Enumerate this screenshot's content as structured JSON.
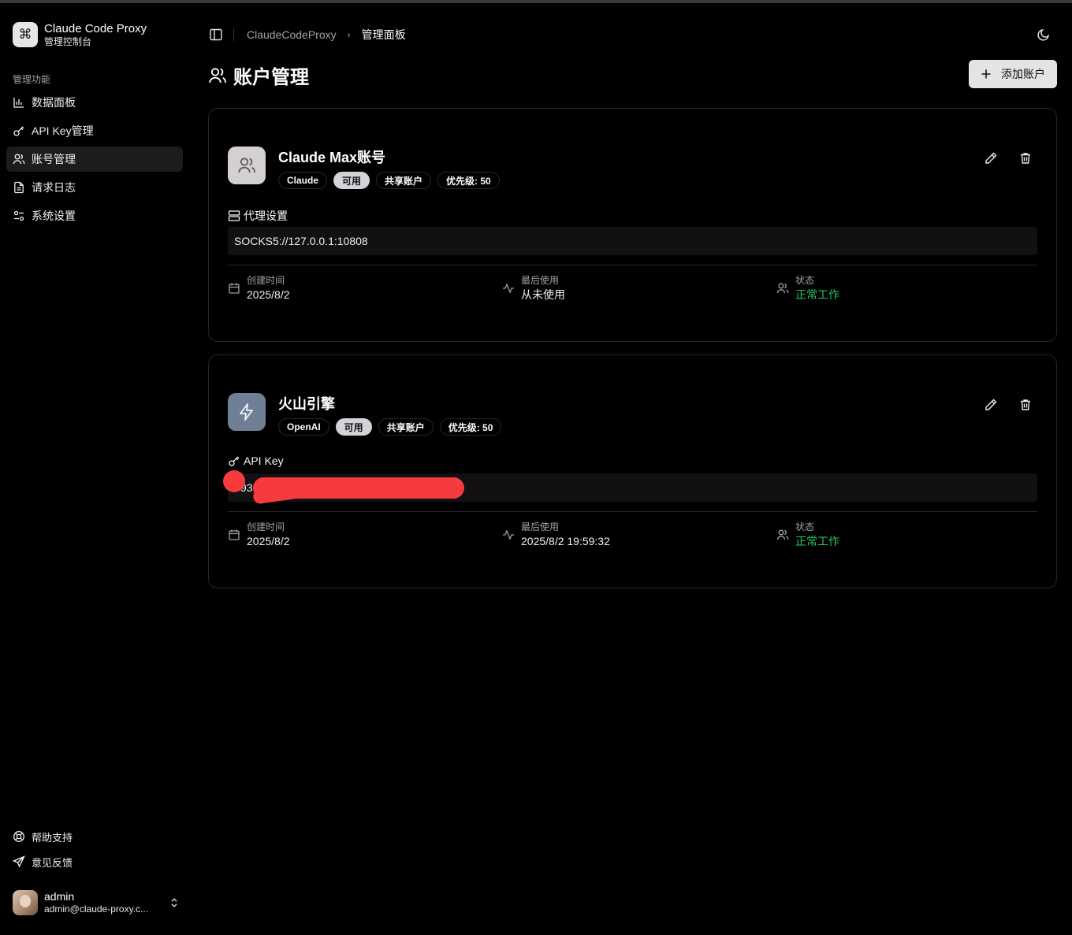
{
  "app": {
    "name": "Claude Code Proxy",
    "subtitle": "管理控制台"
  },
  "sidebar": {
    "section_label": "管理功能",
    "items": [
      {
        "label": "数据面板",
        "icon": "bar-chart-icon"
      },
      {
        "label": "API Key管理",
        "icon": "key-icon"
      },
      {
        "label": "账号管理",
        "icon": "users-icon",
        "active": true
      },
      {
        "label": "请求日志",
        "icon": "file-text-icon"
      },
      {
        "label": "系统设置",
        "icon": "settings-sliders-icon"
      }
    ],
    "footer_items": [
      {
        "label": "帮助支持",
        "icon": "life-buoy-icon"
      },
      {
        "label": "意见反馈",
        "icon": "send-icon"
      }
    ]
  },
  "user": {
    "name": "admin",
    "email": "admin@claude-proxy.c..."
  },
  "breadcrumb": {
    "root": "ClaudeCodeProxy",
    "current": "管理面板"
  },
  "page": {
    "title": "账户管理",
    "add_button": "添加账户"
  },
  "accounts": [
    {
      "name": "Claude Max账号",
      "icon": "users-icon",
      "badges": [
        "Claude",
        "可用",
        "共享账户",
        "优先级: 50"
      ],
      "field_label": "代理设置",
      "field_icon": "server-icon",
      "field_value": "SOCKS5://127.0.0.1:10808",
      "created_label": "创建时间",
      "created_value": "2025/8/2",
      "last_used_label": "最后使用",
      "last_used_value": "从未使用",
      "status_label": "状态",
      "status_value": "正常工作"
    },
    {
      "name": "火山引擎",
      "icon": "zap-icon",
      "badges": [
        "OpenAI",
        "可用",
        "共享账户",
        "优先级: 50"
      ],
      "field_label": "API Key",
      "field_icon": "key-icon",
      "field_value": "935",
      "created_label": "创建时间",
      "created_value": "2025/8/2",
      "last_used_label": "最后使用",
      "last_used_value": "2025/8/2 19:59:32",
      "status_label": "状态",
      "status_value": "正常工作"
    }
  ],
  "colors": {
    "status_ok": "#22c55e",
    "redaction": "#f53b3e",
    "card_border": "#262626"
  }
}
